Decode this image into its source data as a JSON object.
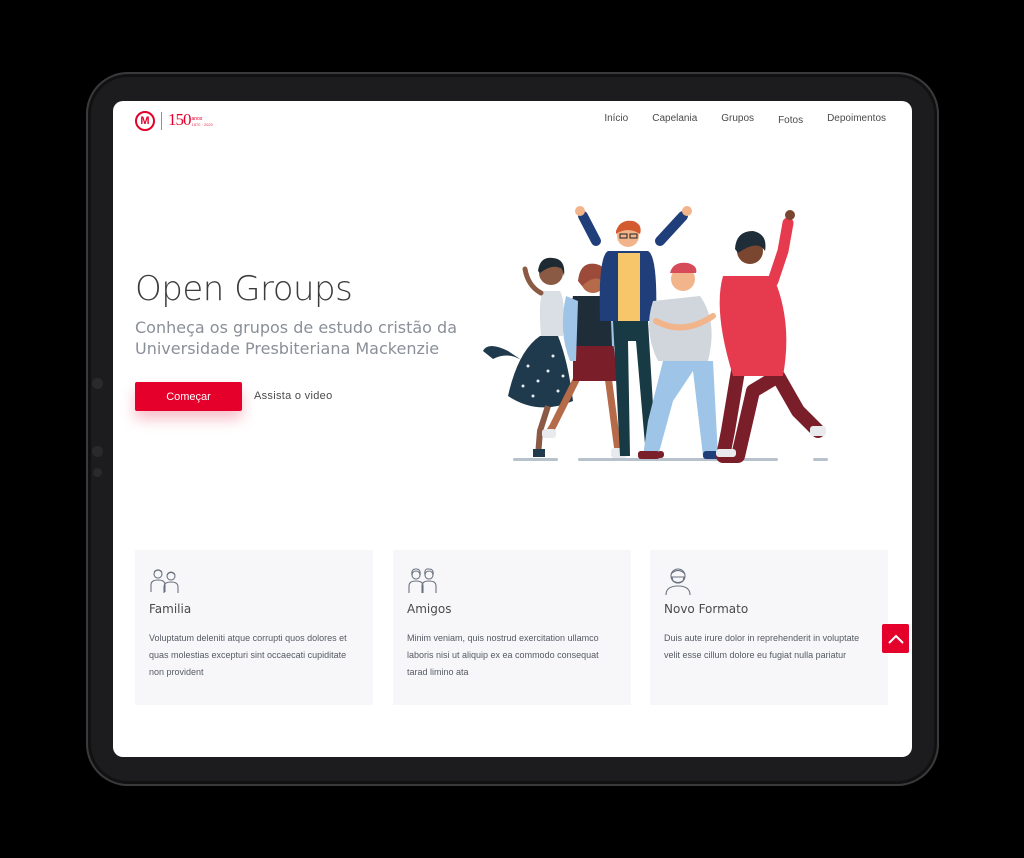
{
  "brand": {
    "logo_letter": "M",
    "anniversary": "150",
    "anniversary_word": "anos",
    "anniversary_years": "1870 · 2020",
    "color": "#e4002b"
  },
  "nav": {
    "items": [
      {
        "label": "Início"
      },
      {
        "label": "Capelania"
      },
      {
        "label": "Grupos"
      },
      {
        "label": "Fotos"
      },
      {
        "label": "Depoimentos"
      }
    ]
  },
  "hero": {
    "title": "Open Groups",
    "subtitle": "Conheça os grupos de estudo cristão da Universidade Presbiteriana Mackenzie",
    "cta_label": "Começar",
    "video_link": "Assista o video",
    "illustration_icon": "group-of-friends-illustration"
  },
  "cards": [
    {
      "title": "Familia",
      "icon": "family-icon",
      "text": "Voluptatum deleniti atque corrupti quos dolores et quas molestias excepturi sint occaecati cupiditate non provident"
    },
    {
      "title": "Amigos",
      "icon": "friends-icon",
      "text": "Minim veniam, quis nostrud exercitation ullamco laboris nisi ut aliquip ex ea commodo consequat tarad limino ata"
    },
    {
      "title": "Novo Formato",
      "icon": "masked-person-icon",
      "text": "Duis aute irure dolor in reprehenderit in voluptate velit esse cillum dolore eu fugiat nulla pariatur"
    }
  ],
  "scroll_top": {
    "icon": "chevron-up-icon"
  }
}
